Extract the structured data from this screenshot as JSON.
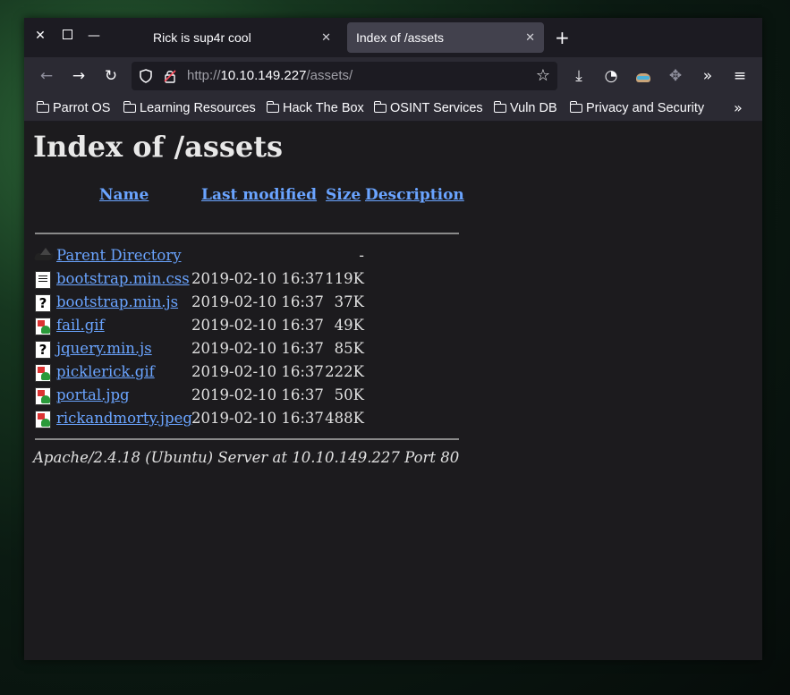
{
  "tabs": [
    {
      "label": "Rick is sup4r cool",
      "active": false
    },
    {
      "label": "Index of /assets",
      "active": true
    }
  ],
  "url": {
    "prefix": "http://",
    "host": "10.10.149.227",
    "path": "/assets/"
  },
  "bookmarks": [
    "Parrot OS",
    "Learning Resources",
    "Hack The Box",
    "OSINT Services",
    "Vuln DB",
    "Privacy and Security"
  ],
  "page": {
    "title": "Index of /assets",
    "columns": {
      "name": "Name",
      "modified": "Last modified",
      "size": "Size",
      "description": "Description"
    },
    "parent": {
      "name": "Parent Directory",
      "size": "-"
    },
    "files": [
      {
        "name": "bootstrap.min.css",
        "modified": "2019-02-10 16:37",
        "size": "119K",
        "icon": "text-file-icon"
      },
      {
        "name": "bootstrap.min.js",
        "modified": "2019-02-10 16:37",
        "size": "37K",
        "icon": "unknown-file-icon"
      },
      {
        "name": "fail.gif",
        "modified": "2019-02-10 16:37",
        "size": "49K",
        "icon": "image-file-icon"
      },
      {
        "name": "jquery.min.js",
        "modified": "2019-02-10 16:37",
        "size": "85K",
        "icon": "unknown-file-icon"
      },
      {
        "name": "picklerick.gif",
        "modified": "2019-02-10 16:37",
        "size": "222K",
        "icon": "image-file-icon"
      },
      {
        "name": "portal.jpg",
        "modified": "2019-02-10 16:37",
        "size": "50K",
        "icon": "image-file-icon"
      },
      {
        "name": "rickandmorty.jpeg",
        "modified": "2019-02-10 16:37",
        "size": "488K",
        "icon": "image-file-icon"
      }
    ],
    "address": "Apache/2.4.18 (Ubuntu) Server at 10.10.149.227 Port 80"
  },
  "colors": {
    "link": "#6aa4ff",
    "page_bg": "#1c1b1e",
    "toolbar_bg": "#2b2a33"
  }
}
